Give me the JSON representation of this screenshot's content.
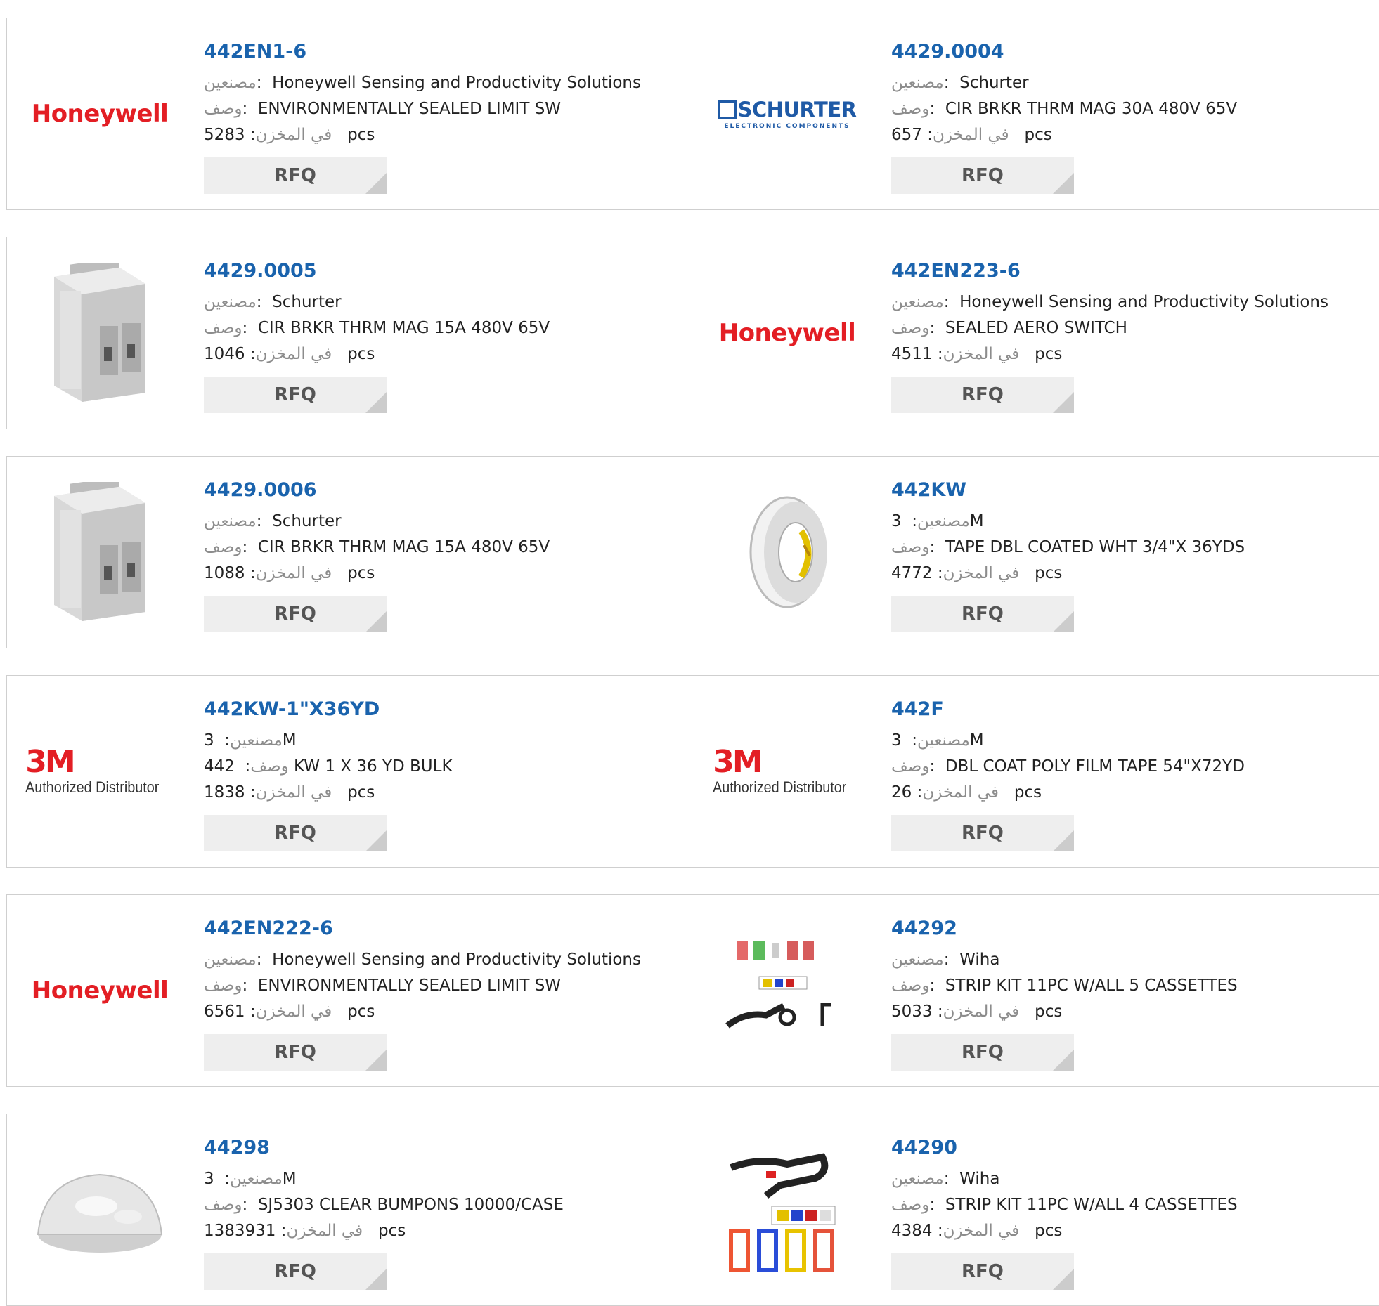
{
  "labels": {
    "manufacturer": "مصنعين",
    "description": "وصف",
    "stock": "في المخزن",
    "unit": "pcs",
    "rfq": "RFQ"
  },
  "products": [
    {
      "pn": "442EN1-6",
      "manufacturer": "Honeywell Sensing and Productivity Solutions",
      "description": "ENVIRONMENTALLY SEALED LIMIT SW",
      "stock": "5283",
      "logo": "honeywell-logo"
    },
    {
      "pn": "4429.0004",
      "manufacturer": "Schurter",
      "description": "CIR BRKR THRM MAG 30A 480V 65V",
      "stock": "657",
      "logo": "schurter-logo",
      "logo_text": "SCHURTER",
      "logo_sub": "ELECTRONIC COMPONENTS"
    },
    {
      "pn": "4429.0005",
      "manufacturer": "Schurter",
      "description": "CIR BRKR THRM MAG 15A 480V 65V",
      "stock": "1046",
      "logo": "circuit-breaker-image"
    },
    {
      "pn": "442EN223-6",
      "manufacturer": "Honeywell Sensing and Productivity Solutions",
      "description": "SEALED AERO SWITCH",
      "stock": "4511",
      "logo": "honeywell-logo"
    },
    {
      "pn": "4429.0006",
      "manufacturer": "Schurter",
      "description": "CIR BRKR THRM MAG 15A 480V 65V",
      "stock": "1088",
      "logo": "circuit-breaker-image"
    },
    {
      "pn": "442KW",
      "manufacturer": "3M",
      "description": "TAPE DBL COATED WHT 3/4\"X 36YDS",
      "stock": "4772",
      "logo": "tape-roll-image"
    },
    {
      "pn": "442KW-1\"X36YD",
      "manufacturer": "3M",
      "description": "442 KW 1 X 36 YD BULK",
      "stock": "1838",
      "logo": "3m-logo"
    },
    {
      "pn": "442F",
      "manufacturer": "3M",
      "description": "DBL COAT POLY FILM TAPE 54\"X72YD",
      "stock": "26",
      "logo": "3m-logo"
    },
    {
      "pn": "442EN222-6",
      "manufacturer": "Honeywell Sensing and Productivity Solutions",
      "description": "ENVIRONMENTALLY SEALED LIMIT SW",
      "stock": "6561",
      "logo": "honeywell-logo"
    },
    {
      "pn": "44292",
      "manufacturer": "Wiha",
      "description": "STRIP KIT 11PC W/ALL 5 CASSETTES",
      "stock": "5033",
      "logo": "strip-kit-image"
    },
    {
      "pn": "44298",
      "manufacturer": "3M",
      "description": "SJ5303 CLEAR BUMPONS 10000/CASE",
      "stock": "1383931",
      "logo": "bumpon-image"
    },
    {
      "pn": "44290",
      "manufacturer": "Wiha",
      "description": "STRIP KIT 11PC W/ALL 4 CASSETTES",
      "stock": "4384",
      "logo": "strip-kit-image"
    }
  ],
  "logo_text": {
    "honeywell": "Honeywell",
    "m3_mark": "3M",
    "m3_sub": "Authorized Distributor"
  },
  "colors": {
    "part_number": "#1a63ad",
    "label": "#8c8c8c",
    "honeywell_red": "#e31e24",
    "schurter_blue": "#1f5aa6",
    "button_bg": "#eeeeee",
    "border": "#cfcfcf"
  }
}
